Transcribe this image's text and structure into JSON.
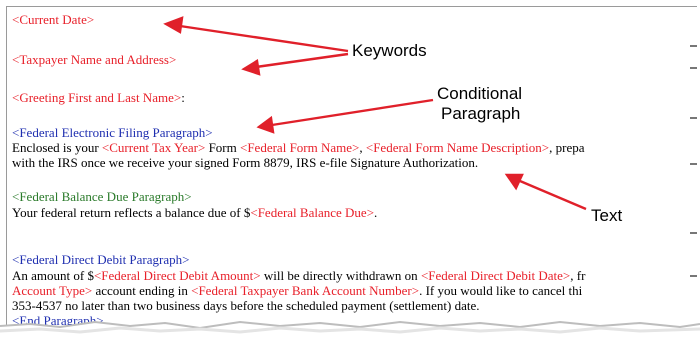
{
  "document": {
    "current_date": "<Current Date>",
    "taxpayer_name": "<Taxpayer Name and Address>",
    "greeting": "<Greeting First and Last Name>",
    "greeting_colon": ":",
    "fed_efile_para": "<Federal Electronic Filing Paragraph>",
    "efile_line1": {
      "a": "Enclosed is your ",
      "b": "<Current Tax Year>",
      "c": " Form ",
      "d": "<Federal Form Name>",
      "e": ", ",
      "f": "<Federal Form Name Description>",
      "g": ", prepa"
    },
    "efile_line2": "with the IRS once we receive your signed Form 8879, IRS e-file Signature Authorization.",
    "fed_balance_para": "<Federal Balance Due Paragraph>",
    "balance_line": {
      "a": "Your federal return reflects a balance due of $",
      "b": "<Federal Balance Due>",
      "c": "."
    },
    "fed_debit_para": "<Federal Direct Debit Paragraph>",
    "debit_line1": {
      "a": "An amount of $",
      "b": "<Federal Direct Debit Amount>",
      "c": " will be directly withdrawn on ",
      "d": "<Federal Direct Debit Date>",
      "e": ", fr"
    },
    "debit_line2": {
      "a": "Account Type>",
      "b": " account ending in ",
      "c": "<Federal Taxpayer Bank Account Number>",
      "d": ". If you would like to cancel thi"
    },
    "debit_line3": "353-4537 no later than two business days before the scheduled payment (settlement) date.",
    "end_para": "<End Paragraph>"
  },
  "annotations": {
    "keywords": "Keywords",
    "conditional": "Conditional",
    "paragraph": "Paragraph",
    "text": "Text"
  },
  "colors": {
    "keyword_red": "#e8202a",
    "paragraph_blue": "#1f2fb0",
    "paragraph_green": "#2a7a2a",
    "arrow_red": "#e0202a"
  }
}
